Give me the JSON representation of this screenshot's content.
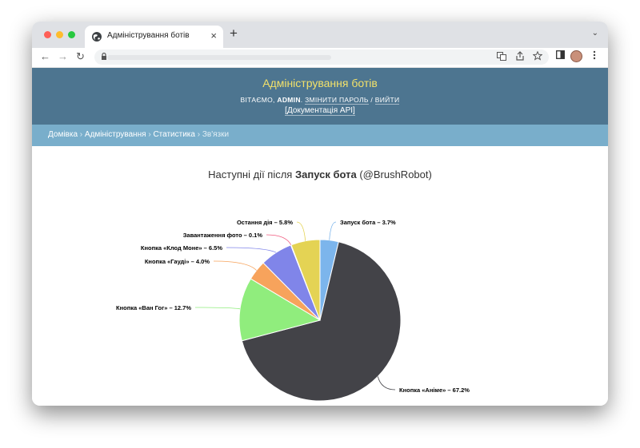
{
  "browser": {
    "tab_title": "Адміністрування ботів",
    "new_tab": "+",
    "close": "×",
    "tab_menu": "⌄",
    "nav": {
      "back": "←",
      "forward": "→",
      "reload": "↻"
    }
  },
  "site": {
    "title": "Адміністрування ботів",
    "welcome": "ВІТАЄМО,",
    "username": "ADMIN",
    "change_password": "ЗМІНИТИ ПАРОЛЬ",
    "separator": "/",
    "logout": "ВИЙТИ",
    "docs": "[Документація API]"
  },
  "breadcrumbs": {
    "home": "Домівка",
    "admin": "Адміністрування",
    "stats": "Статистика",
    "current": "Зв'язки",
    "sep": "›"
  },
  "chart_data": {
    "type": "pie",
    "title_prefix": "Наступні дії після ",
    "title_bold": "Запуск бота",
    "title_suffix": " (@BrushRobot)",
    "slices": [
      {
        "label": "Запуск бота",
        "value": 3.7,
        "display": "Запуск бота – 3.7%",
        "color": "#7cb5ec"
      },
      {
        "label": "Кнопка «Аніме»",
        "value": 67.2,
        "display": "Кнопка «Аніме» – 67.2%",
        "color": "#434348"
      },
      {
        "label": "Кнопка «Ван Гог»",
        "value": 12.7,
        "display": "Кнопка «Ван Гог» – 12.7%",
        "color": "#90ed7d"
      },
      {
        "label": "Кнопка «Гауді»",
        "value": 4.0,
        "display": "Кнопка «Гауді» – 4.0%",
        "color": "#f7a35c"
      },
      {
        "label": "Кнопка «Клод Моне»",
        "value": 6.5,
        "display": "Кнопка «Клод Моне» – 6.5%",
        "color": "#8085e9"
      },
      {
        "label": "Завантаження фото",
        "value": 0.1,
        "display": "Завантаження фото – 0.1%",
        "color": "#f15c80"
      },
      {
        "label": "Остання дія",
        "value": 5.8,
        "display": "Остання дія – 5.8%",
        "color": "#e4d354"
      }
    ]
  }
}
